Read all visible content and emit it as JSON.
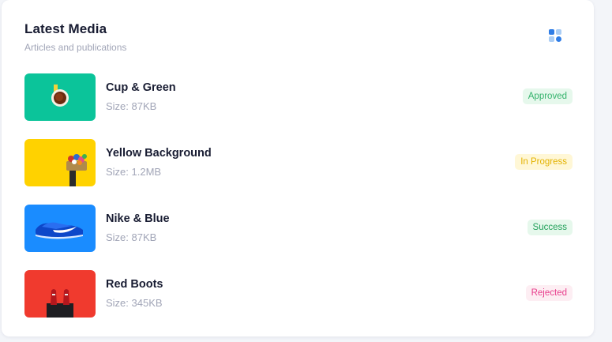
{
  "widget": {
    "title": "Latest Media",
    "subtitle": "Articles and publications"
  },
  "items": [
    {
      "name": "Cup & Green",
      "size": "Size: 87KB",
      "status": "Approved",
      "thumb_bg": "#0bc49a",
      "status_color": "#33b26b",
      "status_bg": "#e6f8ec"
    },
    {
      "name": "Yellow Background",
      "size": "Size: 1.2MB",
      "status": "In Progress",
      "thumb_bg": "#ffd200",
      "status_color": "#e3b200",
      "status_bg": "#fff7d6"
    },
    {
      "name": "Nike & Blue",
      "size": "Size: 87KB",
      "status": "Success",
      "thumb_bg": "#1a8cff",
      "status_color": "#22a05a",
      "status_bg": "#e6f8ec"
    },
    {
      "name": "Red Boots",
      "size": "Size: 345KB",
      "status": "Rejected",
      "thumb_bg": "#f03a2e",
      "status_color": "#e83e8c",
      "status_bg": "#fdeef3"
    }
  ]
}
